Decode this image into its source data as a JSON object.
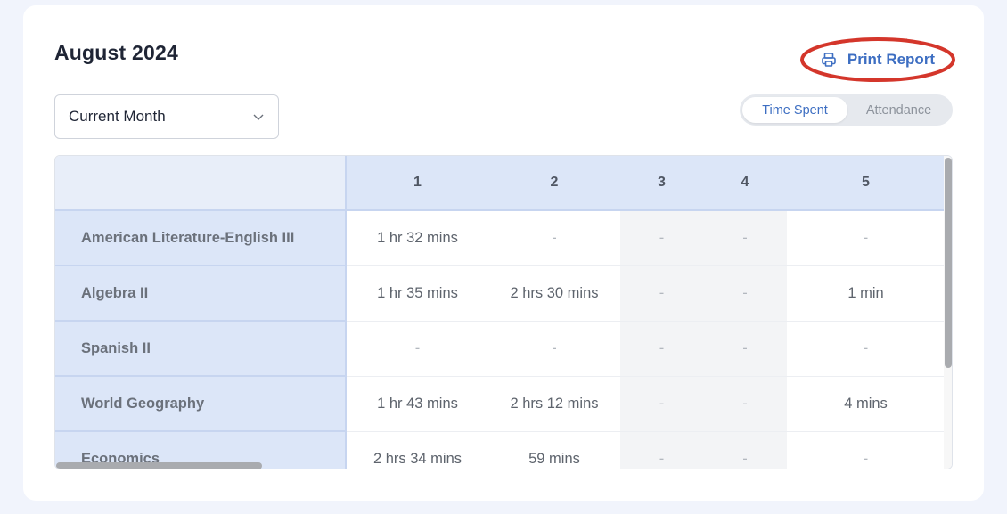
{
  "header": {
    "title": "August 2024",
    "print_label": "Print Report",
    "print_icon": "printer-icon"
  },
  "filter": {
    "selected": "Current Month",
    "chevron_icon": "chevron-down-icon"
  },
  "toggle": {
    "options": [
      "Time Spent",
      "Attendance"
    ],
    "active": "Time Spent"
  },
  "table": {
    "days": [
      "1",
      "2",
      "3",
      "4",
      "5"
    ],
    "weekend_days": [
      "3",
      "4"
    ],
    "rows": [
      {
        "subject": "American Literature-English III",
        "values": [
          "1 hr 32 mins",
          "-",
          "-",
          "-",
          "-"
        ]
      },
      {
        "subject": "Algebra II",
        "values": [
          "1 hr 35 mins",
          "2 hrs 30 mins",
          "-",
          "-",
          "1 min"
        ]
      },
      {
        "subject": "Spanish II",
        "values": [
          "-",
          "-",
          "-",
          "-",
          "-"
        ]
      },
      {
        "subject": "World Geography",
        "values": [
          "1 hr 43 mins",
          "2 hrs 12 mins",
          "-",
          "-",
          "4 mins"
        ]
      },
      {
        "subject": "Economics",
        "values": [
          "2 hrs 34 mins",
          "59 mins",
          "-",
          "-",
          "-"
        ]
      }
    ]
  },
  "colors": {
    "accent": "#3d6ec2",
    "annotation_ring": "#d4362b",
    "header_bg": "#dce6f8"
  }
}
